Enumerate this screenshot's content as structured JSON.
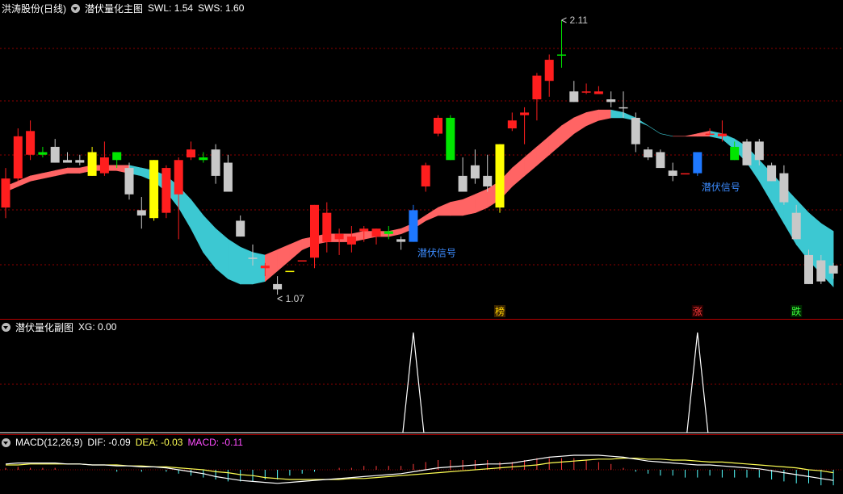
{
  "main": {
    "stock_label": "洪涛股份(日线)",
    "indicator_name": "潜伏量化主图",
    "swl": "SWL: 1.54",
    "sws": "SWS: 1.60",
    "high_label": "2.11",
    "low_label": "1.07",
    "signal_1": "潜伏信号",
    "signal_2": "潜伏信号",
    "tag_bang": "榜",
    "tag_zhang": "涨",
    "tag_die": "跌"
  },
  "sub": {
    "indicator_name": "潜伏量化副图",
    "xg": "XG: 0.00"
  },
  "macd": {
    "name": "MACD(12,26,9)",
    "dif": "DIF: -0.09",
    "dea": "DEA: -0.03",
    "macd": "MACD: -0.11"
  },
  "colors": {
    "up": "#ff1e1e",
    "down": "#c8c8c8",
    "yellow": "#ffff00",
    "green": "#00e600",
    "blue": "#1e78ff",
    "band_up": "#ff6464",
    "band_down": "#3cc8d2",
    "grid": "#8c0000"
  },
  "candles": [
    {
      "o": 1.4,
      "h": 1.55,
      "l": 1.36,
      "c": 1.51,
      "t": "up"
    },
    {
      "o": 1.51,
      "h": 1.7,
      "l": 1.5,
      "c": 1.67,
      "t": "up"
    },
    {
      "o": 1.6,
      "h": 1.73,
      "l": 1.58,
      "c": 1.69,
      "t": "up"
    },
    {
      "o": 1.61,
      "h": 1.63,
      "l": 1.59,
      "c": 1.6,
      "t": "green"
    },
    {
      "o": 1.63,
      "h": 1.66,
      "l": 1.57,
      "c": 1.57,
      "t": "down"
    },
    {
      "o": 1.58,
      "h": 1.61,
      "l": 1.57,
      "c": 1.57,
      "t": "down"
    },
    {
      "o": 1.58,
      "h": 1.6,
      "l": 1.56,
      "c": 1.57,
      "t": "down"
    },
    {
      "o": 1.52,
      "h": 1.63,
      "l": 1.52,
      "c": 1.61,
      "t": "yellow"
    },
    {
      "o": 1.53,
      "h": 1.65,
      "l": 1.52,
      "c": 1.59,
      "t": "up"
    },
    {
      "o": 1.58,
      "h": 1.6,
      "l": 1.55,
      "c": 1.61,
      "t": "green"
    },
    {
      "o": 1.55,
      "h": 1.57,
      "l": 1.43,
      "c": 1.45,
      "t": "down"
    },
    {
      "o": 1.37,
      "h": 1.44,
      "l": 1.32,
      "c": 1.39,
      "t": "down"
    },
    {
      "o": 1.36,
      "h": 1.58,
      "l": 1.35,
      "c": 1.58,
      "t": "yellow"
    },
    {
      "o": 1.38,
      "h": 1.56,
      "l": 1.36,
      "c": 1.55,
      "t": "up"
    },
    {
      "o": 1.45,
      "h": 1.59,
      "l": 1.28,
      "c": 1.58,
      "t": "up"
    },
    {
      "o": 1.59,
      "h": 1.65,
      "l": 1.58,
      "c": 1.62,
      "t": "up"
    },
    {
      "o": 1.59,
      "h": 1.61,
      "l": 1.57,
      "c": 1.58,
      "t": "green"
    },
    {
      "o": 1.62,
      "h": 1.64,
      "l": 1.49,
      "c": 1.52,
      "t": "down"
    },
    {
      "o": 1.57,
      "h": 1.6,
      "l": 1.48,
      "c": 1.46,
      "t": "down"
    },
    {
      "o": 1.35,
      "h": 1.37,
      "l": 1.29,
      "c": 1.29,
      "t": "down"
    },
    {
      "o": 1.21,
      "h": 1.26,
      "l": 1.18,
      "c": 1.21,
      "t": "down"
    },
    {
      "o": 1.18,
      "h": 1.19,
      "l": 1.14,
      "c": 1.17,
      "t": "up"
    },
    {
      "o": 1.11,
      "h": 1.14,
      "l": 1.07,
      "c": 1.09,
      "t": "down"
    },
    {
      "o": 1.16,
      "h": 1.16,
      "l": 1.16,
      "c": 1.16,
      "t": "yellow"
    },
    {
      "o": 1.2,
      "h": 1.2,
      "l": 1.2,
      "c": 1.2,
      "t": "up"
    },
    {
      "o": 1.21,
      "h": 1.41,
      "l": 1.17,
      "c": 1.41,
      "t": "up"
    },
    {
      "o": 1.27,
      "h": 1.42,
      "l": 1.23,
      "c": 1.38,
      "t": "up"
    },
    {
      "o": 1.3,
      "h": 1.32,
      "l": 1.22,
      "c": 1.28,
      "t": "up"
    },
    {
      "o": 1.26,
      "h": 1.33,
      "l": 1.23,
      "c": 1.29,
      "t": "up"
    },
    {
      "o": 1.32,
      "h": 1.33,
      "l": 1.27,
      "c": 1.31,
      "t": "up"
    },
    {
      "o": 1.29,
      "h": 1.32,
      "l": 1.26,
      "c": 1.32,
      "t": "up"
    },
    {
      "o": 1.3,
      "h": 1.33,
      "l": 1.28,
      "c": 1.31,
      "t": "green"
    },
    {
      "o": 1.27,
      "h": 1.29,
      "l": 1.24,
      "c": 1.28,
      "t": "down"
    },
    {
      "o": 1.27,
      "h": 1.41,
      "l": 1.27,
      "c": 1.39,
      "t": "blue"
    },
    {
      "o": 1.48,
      "h": 1.57,
      "l": 1.46,
      "c": 1.56,
      "t": "up"
    },
    {
      "o": 1.68,
      "h": 1.75,
      "l": 1.67,
      "c": 1.74,
      "t": "up"
    },
    {
      "o": 1.74,
      "h": 1.75,
      "l": 1.58,
      "c": 1.58,
      "t": "green"
    },
    {
      "o": 1.52,
      "h": 1.59,
      "l": 1.52,
      "c": 1.46,
      "t": "down"
    },
    {
      "o": 1.56,
      "h": 1.62,
      "l": 1.49,
      "c": 1.51,
      "t": "down"
    },
    {
      "o": 1.52,
      "h": 1.6,
      "l": 1.46,
      "c": 1.48,
      "t": "down"
    },
    {
      "o": 1.4,
      "h": 1.64,
      "l": 1.38,
      "c": 1.64,
      "t": "yellow"
    },
    {
      "o": 1.7,
      "h": 1.76,
      "l": 1.69,
      "c": 1.73,
      "t": "up"
    },
    {
      "o": 1.75,
      "h": 1.78,
      "l": 1.64,
      "c": 1.76,
      "t": "up"
    },
    {
      "o": 1.81,
      "h": 1.91,
      "l": 1.73,
      "c": 1.9,
      "t": "up"
    },
    {
      "o": 1.88,
      "h": 1.98,
      "l": 1.82,
      "c": 1.96,
      "t": "up"
    },
    {
      "o": 1.98,
      "h": 2.11,
      "l": 1.93,
      "c": 1.98,
      "t": "green"
    },
    {
      "o": 1.84,
      "h": 1.88,
      "l": 1.8,
      "c": 1.8,
      "t": "down"
    },
    {
      "o": 1.84,
      "h": 1.87,
      "l": 1.83,
      "c": 1.84,
      "t": "up"
    },
    {
      "o": 1.84,
      "h": 1.86,
      "l": 1.83,
      "c": 1.83,
      "t": "up"
    },
    {
      "o": 1.81,
      "h": 1.84,
      "l": 1.78,
      "c": 1.8,
      "t": "down"
    },
    {
      "o": 1.78,
      "h": 1.84,
      "l": 1.74,
      "c": 1.78,
      "t": "down"
    },
    {
      "o": 1.74,
      "h": 1.76,
      "l": 1.61,
      "c": 1.64,
      "t": "down"
    },
    {
      "o": 1.62,
      "h": 1.63,
      "l": 1.58,
      "c": 1.59,
      "t": "down"
    },
    {
      "o": 1.61,
      "h": 1.62,
      "l": 1.55,
      "c": 1.55,
      "t": "down"
    },
    {
      "o": 1.54,
      "h": 1.57,
      "l": 1.5,
      "c": 1.52,
      "t": "down"
    },
    {
      "o": 1.53,
      "h": 1.53,
      "l": 1.53,
      "c": 1.53,
      "t": "up"
    },
    {
      "o": 1.53,
      "h": 1.61,
      "l": 1.52,
      "c": 1.61,
      "t": "blue"
    },
    {
      "o": 1.68,
      "h": 1.7,
      "l": 1.68,
      "c": 1.68,
      "t": "up"
    },
    {
      "o": 1.68,
      "h": 1.73,
      "l": 1.65,
      "c": 1.67,
      "t": "up"
    },
    {
      "o": 1.63,
      "h": 1.65,
      "l": 1.58,
      "c": 1.58,
      "t": "green"
    },
    {
      "o": 1.65,
      "h": 1.66,
      "l": 1.56,
      "c": 1.56,
      "t": "down"
    },
    {
      "o": 1.65,
      "h": 1.66,
      "l": 1.56,
      "c": 1.58,
      "t": "down"
    },
    {
      "o": 1.56,
      "h": 1.57,
      "l": 1.5,
      "c": 1.5,
      "t": "down"
    },
    {
      "o": 1.53,
      "h": 1.56,
      "l": 1.41,
      "c": 1.42,
      "t": "down"
    },
    {
      "o": 1.38,
      "h": 1.41,
      "l": 1.28,
      "c": 1.28,
      "t": "down"
    },
    {
      "o": 1.22,
      "h": 1.24,
      "l": 1.11,
      "c": 1.11,
      "t": "down"
    },
    {
      "o": 1.2,
      "h": 1.22,
      "l": 1.11,
      "c": 1.12,
      "t": "down"
    },
    {
      "o": 1.18,
      "h": 1.19,
      "l": 1.13,
      "c": 1.15,
      "t": "down"
    }
  ],
  "band": {
    "upper": [
      1.48,
      1.5,
      1.52,
      1.53,
      1.54,
      1.55,
      1.55,
      1.56,
      1.56,
      1.56,
      1.56,
      1.55,
      1.54,
      1.52,
      1.48,
      1.43,
      1.37,
      1.32,
      1.28,
      1.25,
      1.23,
      1.22,
      1.24,
      1.26,
      1.28,
      1.29,
      1.3,
      1.3,
      1.3,
      1.31,
      1.31,
      1.31,
      1.32,
      1.34,
      1.37,
      1.4,
      1.42,
      1.43,
      1.45,
      1.47,
      1.5,
      1.55,
      1.59,
      1.63,
      1.67,
      1.71,
      1.74,
      1.76,
      1.77,
      1.77,
      1.76,
      1.74,
      1.71,
      1.68,
      1.67,
      1.67,
      1.68,
      1.69,
      1.68,
      1.66,
      1.63,
      1.58,
      1.53,
      1.48,
      1.43,
      1.38,
      1.34,
      1.31
    ],
    "lower": [
      1.46,
      1.48,
      1.5,
      1.51,
      1.52,
      1.53,
      1.53,
      1.54,
      1.54,
      1.54,
      1.53,
      1.52,
      1.5,
      1.46,
      1.4,
      1.32,
      1.23,
      1.17,
      1.13,
      1.11,
      1.11,
      1.12,
      1.16,
      1.2,
      1.24,
      1.26,
      1.27,
      1.27,
      1.27,
      1.28,
      1.29,
      1.29,
      1.3,
      1.32,
      1.35,
      1.37,
      1.37,
      1.37,
      1.38,
      1.4,
      1.43,
      1.48,
      1.52,
      1.56,
      1.6,
      1.64,
      1.68,
      1.71,
      1.73,
      1.74,
      1.74,
      1.73,
      1.71,
      1.68,
      1.67,
      1.67,
      1.67,
      1.67,
      1.66,
      1.62,
      1.57,
      1.5,
      1.42,
      1.34,
      1.26,
      1.2,
      1.15,
      1.1
    ]
  },
  "xg_signals": [
    33,
    56
  ],
  "macd_series": {
    "dif": [
      0.06,
      0.07,
      0.07,
      0.07,
      0.07,
      0.06,
      0.06,
      0.05,
      0.05,
      0.04,
      0.04,
      0.03,
      0.03,
      0.02,
      0.0,
      -0.02,
      -0.04,
      -0.07,
      -0.09,
      -0.11,
      -0.12,
      -0.13,
      -0.14,
      -0.13,
      -0.12,
      -0.11,
      -0.1,
      -0.09,
      -0.08,
      -0.07,
      -0.06,
      -0.05,
      -0.04,
      -0.02,
      0.0,
      0.02,
      0.03,
      0.04,
      0.05,
      0.06,
      0.06,
      0.07,
      0.09,
      0.11,
      0.13,
      0.14,
      0.15,
      0.15,
      0.15,
      0.14,
      0.13,
      0.11,
      0.09,
      0.08,
      0.07,
      0.06,
      0.05,
      0.05,
      0.04,
      0.03,
      0.02,
      0.01,
      -0.01,
      -0.03,
      -0.05,
      -0.07,
      -0.09,
      -0.11
    ],
    "dea": [
      0.05,
      0.05,
      0.06,
      0.06,
      0.06,
      0.06,
      0.06,
      0.05,
      0.05,
      0.05,
      0.04,
      0.04,
      0.03,
      0.03,
      0.02,
      0.01,
      0.0,
      -0.02,
      -0.03,
      -0.05,
      -0.06,
      -0.08,
      -0.09,
      -0.1,
      -0.1,
      -0.1,
      -0.1,
      -0.1,
      -0.09,
      -0.09,
      -0.08,
      -0.07,
      -0.06,
      -0.05,
      -0.04,
      -0.03,
      -0.02,
      -0.01,
      0.0,
      0.01,
      0.02,
      0.03,
      0.04,
      0.05,
      0.07,
      0.08,
      0.09,
      0.1,
      0.11,
      0.11,
      0.12,
      0.12,
      0.11,
      0.11,
      0.1,
      0.1,
      0.09,
      0.08,
      0.08,
      0.07,
      0.06,
      0.05,
      0.04,
      0.03,
      0.02,
      0.0,
      -0.01,
      -0.03
    ],
    "hist": [
      0.02,
      0.03,
      0.02,
      0.02,
      0.02,
      0.0,
      0.0,
      0.0,
      0.0,
      -0.02,
      0.0,
      -0.02,
      0.0,
      -0.02,
      -0.04,
      -0.06,
      -0.08,
      -0.1,
      -0.12,
      -0.12,
      -0.12,
      -0.1,
      -0.1,
      -0.06,
      -0.04,
      -0.02,
      0.0,
      0.02,
      0.02,
      0.04,
      0.04,
      0.04,
      0.04,
      0.06,
      0.08,
      0.1,
      0.1,
      0.1,
      0.1,
      0.1,
      0.08,
      0.08,
      0.1,
      0.12,
      0.12,
      0.12,
      0.12,
      0.1,
      0.08,
      0.06,
      0.02,
      -0.02,
      -0.04,
      -0.06,
      -0.06,
      -0.08,
      -0.08,
      -0.06,
      -0.08,
      -0.08,
      -0.08,
      -0.08,
      -0.1,
      -0.12,
      -0.14,
      -0.14,
      -0.16,
      -0.16
    ]
  }
}
